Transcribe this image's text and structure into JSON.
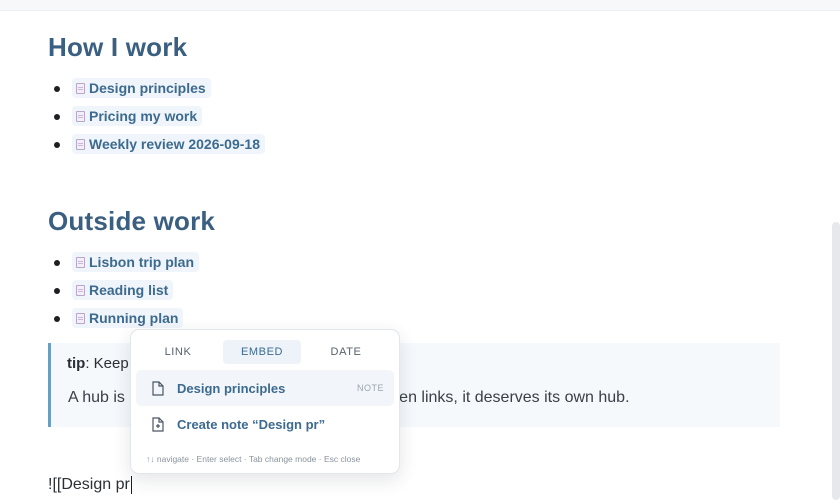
{
  "sections": [
    {
      "title": "How I work",
      "links": [
        "Design principles",
        "Pricing my work",
        "Weekly review 2026-09-18"
      ]
    },
    {
      "title": "Outside work",
      "links": [
        "Lisbon trip plan",
        "Reading list",
        "Running plan"
      ]
    }
  ],
  "callout": {
    "label": "tip",
    "text_visible": ": Keep",
    "body_start": "A hub is",
    "body_end": "ast ten links, it deserves its own hub."
  },
  "editor": {
    "current_line": "![[Design pr"
  },
  "popup": {
    "tabs": [
      "LINK",
      "EMBED",
      "DATE"
    ],
    "active_tab": "EMBED",
    "items": [
      {
        "label": "Design principles",
        "tag": "NOTE",
        "icon": "document-icon"
      },
      {
        "label": "Create note “Design pr”",
        "tag": "",
        "icon": "new-document-icon"
      }
    ],
    "hint": "↑↓ navigate · Enter select · Tab change mode · Esc close"
  },
  "colors": {
    "heading": "#3a5f80",
    "link": "#3d6a8f",
    "accent": "#6d9cc4"
  }
}
